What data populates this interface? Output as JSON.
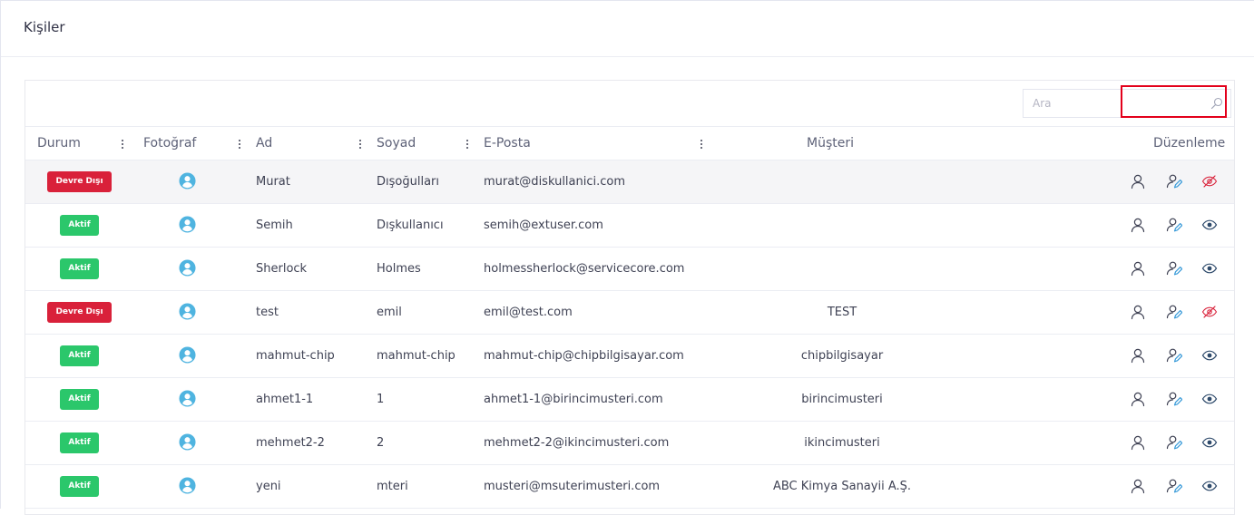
{
  "page": {
    "title": "Kişiler"
  },
  "search": {
    "placeholder": "Ara"
  },
  "columns": {
    "durum": "Durum",
    "fotograf": "Fotoğraf",
    "ad": "Ad",
    "soyad": "Soyad",
    "eposta": "E-Posta",
    "musteri": "Müşteri",
    "duzenleme": "Düzenleme"
  },
  "rows": [
    {
      "status": "Devre Dışı",
      "active": false,
      "first": "Murat",
      "last": "Dışoğulları",
      "email": "murat@diskullanici.com",
      "customer": ""
    },
    {
      "status": "Aktif",
      "active": true,
      "first": "Semih",
      "last": "Dışkullanıcı",
      "email": "semih@extuser.com",
      "customer": ""
    },
    {
      "status": "Aktif",
      "active": true,
      "first": "Sherlock",
      "last": "Holmes",
      "email": "holmessherlock@servicecore.com",
      "customer": ""
    },
    {
      "status": "Devre Dışı",
      "active": false,
      "first": "test",
      "last": "emil",
      "email": "emil@test.com",
      "customer": "TEST"
    },
    {
      "status": "Aktif",
      "active": true,
      "first": "mahmut-chip",
      "last": "mahmut-chip",
      "email": "mahmut-chip@chipbilgisayar.com",
      "customer": "chipbilgisayar"
    },
    {
      "status": "Aktif",
      "active": true,
      "first": "ahmet1-1",
      "last": "1",
      "email": "ahmet1-1@birincimusteri.com",
      "customer": "birincimusteri"
    },
    {
      "status": "Aktif",
      "active": true,
      "first": "mehmet2-2",
      "last": "2",
      "email": "mehmet2-2@ikincimusteri.com",
      "customer": "ikincimusteri"
    },
    {
      "status": "Aktif",
      "active": true,
      "first": "yeni",
      "last": "mteri",
      "email": "musteri@msuterimusteri.com",
      "customer": "ABC Kimya Sanayii A.Ş."
    }
  ],
  "icons": {
    "avatar": "user-circle-icon",
    "view_user": "user-icon",
    "edit_user": "user-edit-icon",
    "visible": "eye-icon",
    "hidden": "eye-off-icon"
  },
  "colors": {
    "inactive_badge": "#d9213a",
    "active_badge": "#2bc76b",
    "avatar": "#4fb4e0",
    "edit_accent": "#3a9bd9",
    "eye_visible": "#2e4a6b",
    "eye_hidden": "#d9213a",
    "highlight": "#e3001b"
  }
}
